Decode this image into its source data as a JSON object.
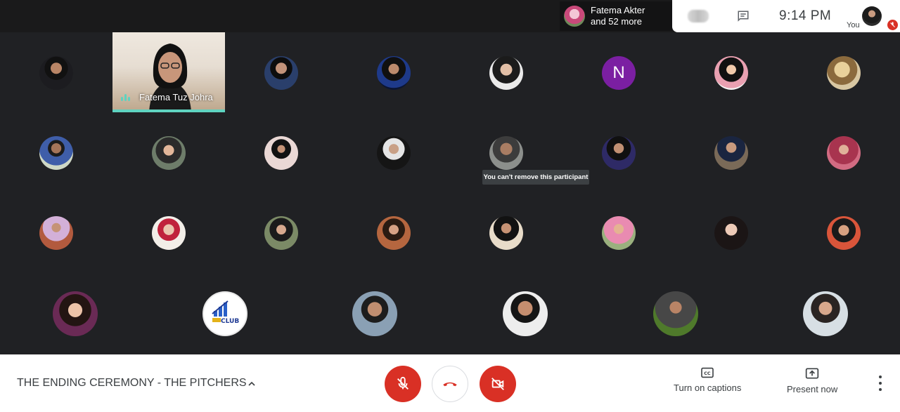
{
  "top_bar": {
    "presenter_name": "Fatema Akter",
    "presenter_more": "and 52 more",
    "clock": "9:14  PM",
    "self_label": "You"
  },
  "video_tile": {
    "name": "Fatema Tuz Johra"
  },
  "participants": {
    "initial_avatar": "N"
  },
  "tooltip": "You can't remove this participant",
  "club_badge_text": "CLUB",
  "bottom_bar": {
    "meeting_title": "THE ENDING CEREMONY - THE PITCHERS",
    "captions_label": "Turn on captions",
    "present_label": "Present now"
  },
  "colors": {
    "background": "#202124",
    "danger": "#d93025",
    "speaking_accent": "#5fd3c0",
    "initial_avatar_bg": "#7b1fa2"
  },
  "icons": [
    "chat-icon",
    "mic-off-icon",
    "end-call-icon",
    "camera-off-icon",
    "captions-icon",
    "present-icon",
    "more-vert-icon",
    "chevron-up-icon"
  ]
}
